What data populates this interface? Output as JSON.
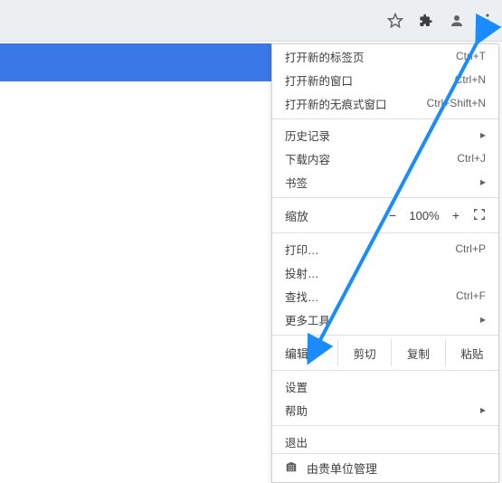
{
  "toolbar": {
    "icons": [
      "star-icon",
      "extensions-icon",
      "profile-icon",
      "kebab-menu-icon"
    ]
  },
  "menu": {
    "new_tab": {
      "label": "打开新的标签页",
      "shortcut": "Ctrl+T"
    },
    "new_window": {
      "label": "打开新的窗口",
      "shortcut": "Ctrl+N"
    },
    "new_incognito": {
      "label": "打开新的无痕式窗口",
      "shortcut": "Ctrl+Shift+N"
    },
    "history": {
      "label": "历史记录"
    },
    "downloads": {
      "label": "下载内容",
      "shortcut": "Ctrl+J"
    },
    "bookmarks": {
      "label": "书签"
    },
    "zoom": {
      "label": "缩放",
      "minus": "−",
      "value": "100%",
      "plus": "+"
    },
    "print": {
      "label": "打印…",
      "shortcut": "Ctrl+P"
    },
    "cast": {
      "label": "投射…"
    },
    "find": {
      "label": "查找…",
      "shortcut": "Ctrl+F"
    },
    "more_tools": {
      "label": "更多工具"
    },
    "edit": {
      "label": "编辑",
      "cut": "剪切",
      "copy": "复制",
      "paste": "粘贴"
    },
    "settings": {
      "label": "设置"
    },
    "help": {
      "label": "帮助"
    },
    "exit": {
      "label": "退出"
    },
    "managed": {
      "label": "由贵单位管理"
    }
  }
}
